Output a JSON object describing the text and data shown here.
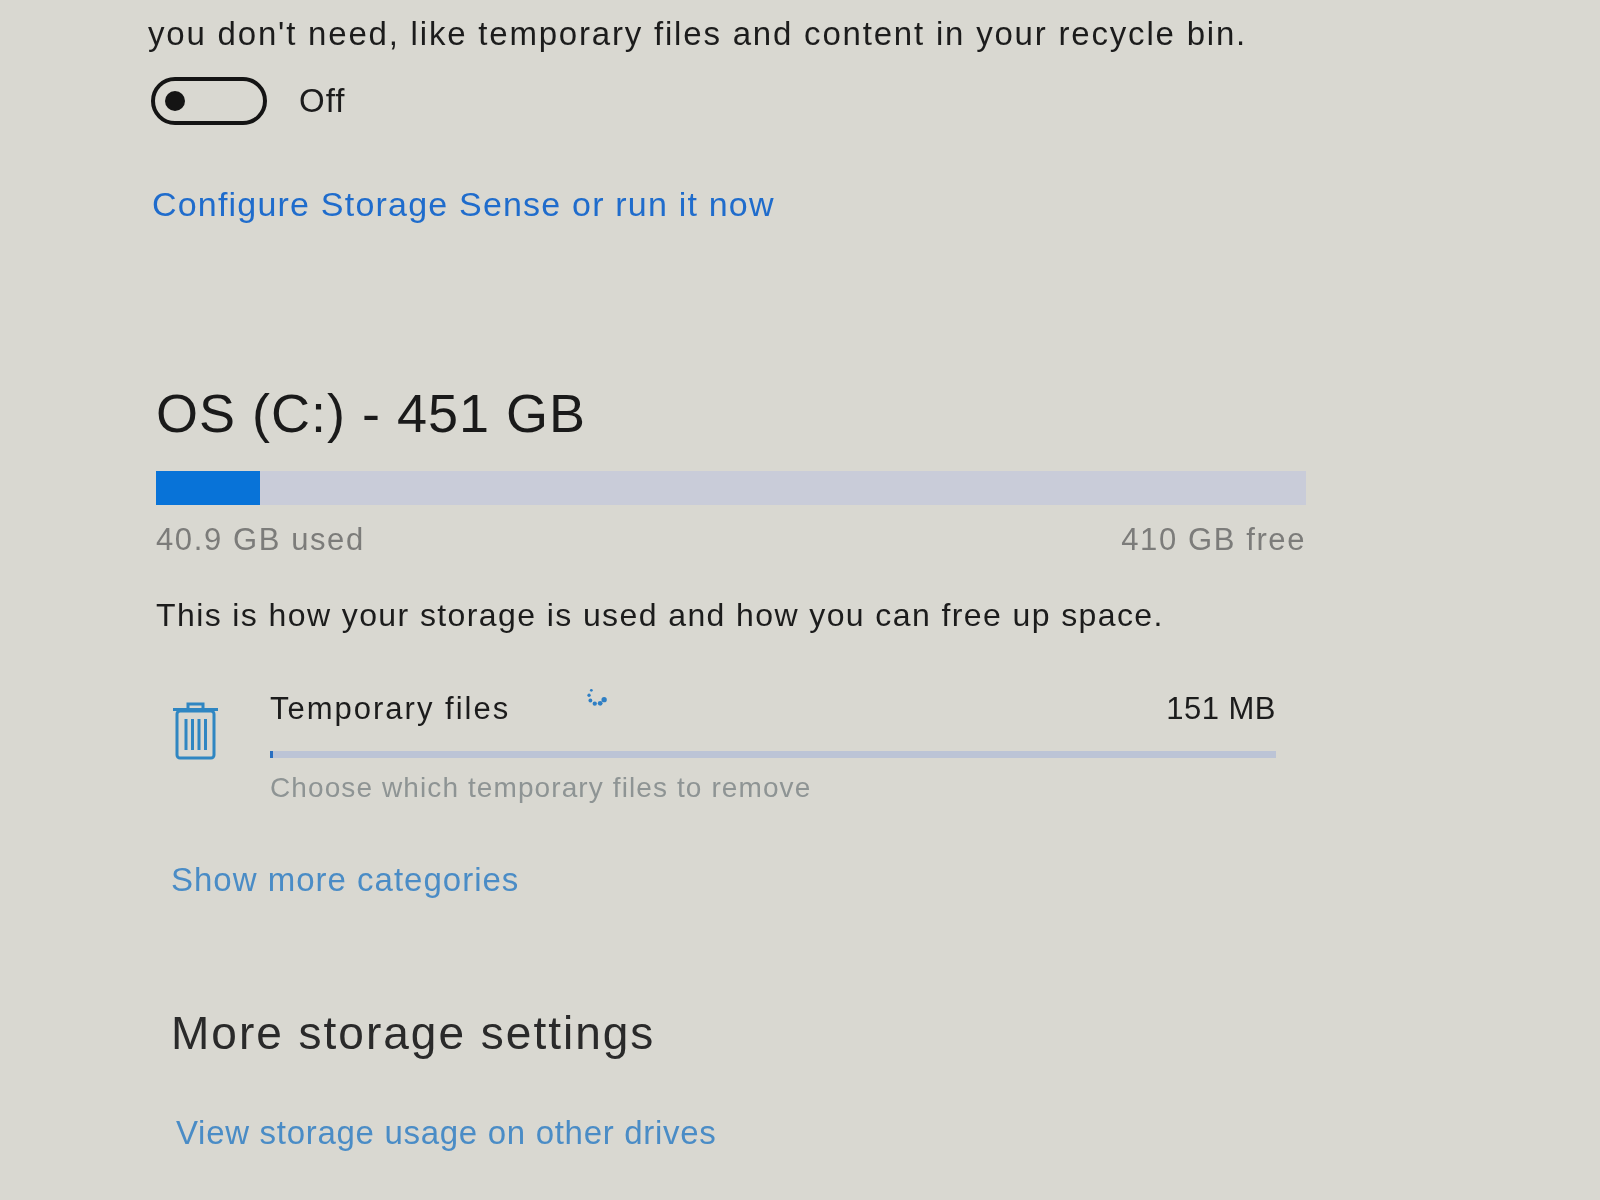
{
  "description_tail": "you don't need, like temporary files and content in your recycle bin.",
  "storage_sense_toggle": {
    "on": false,
    "label": "Off"
  },
  "configure_link": "Configure Storage Sense or run it now",
  "drive": {
    "title": "OS (C:) - 451 GB",
    "level": 0.09,
    "used": "40.9 GB used",
    "free": "410 GB free"
  },
  "usage_intro": "This is how your storage is used and how you can free up space.",
  "categories": [
    {
      "name": "Temporary files",
      "size": "151 MB",
      "level": 0.003,
      "hint": "Choose which temporary files to remove",
      "loading": true
    }
  ],
  "show_more_link": "Show more categories",
  "more_settings": {
    "heading": "More storage settings",
    "links": [
      "View storage usage on other drives"
    ]
  }
}
